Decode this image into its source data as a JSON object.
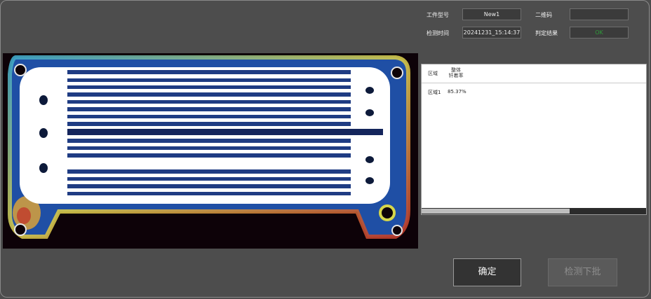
{
  "header": {
    "part_no_label": "工件型号",
    "part_no_value": "New1",
    "qr_label": "二维码",
    "qr_value": "",
    "time_label": "检测时间",
    "time_value": "20241231_15:14:37",
    "result_label": "判定结果",
    "result_value": "OK",
    "result_color": "#2f9a3a"
  },
  "results_table": {
    "col1_header": "区域",
    "col2_header_line1": "整体",
    "col2_header_line2": "钎着率",
    "rows": [
      {
        "region": "区域1",
        "rate": "85.37%"
      }
    ],
    "scroll_fraction": 0.66
  },
  "buttons": {
    "confirm_label": "确定",
    "next_batch_label": "检测下批"
  }
}
